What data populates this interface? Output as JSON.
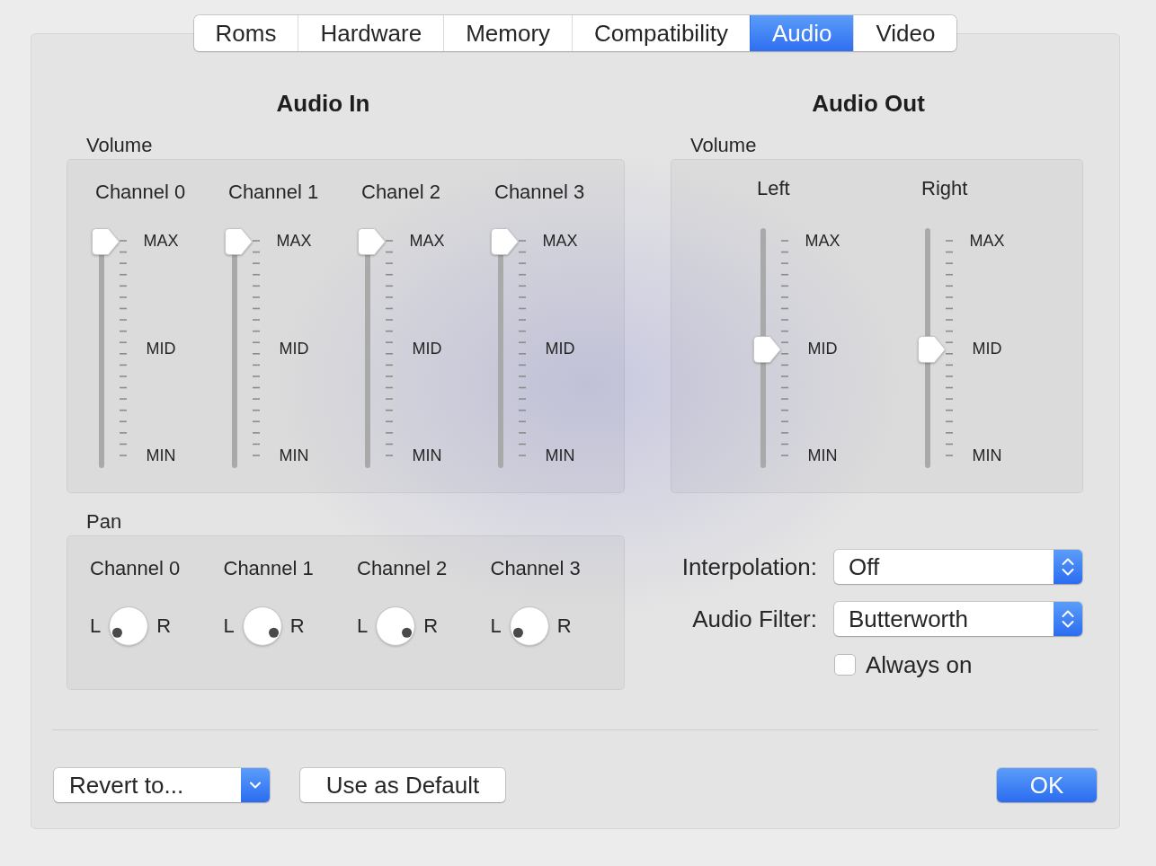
{
  "tabs": [
    {
      "label": "Roms",
      "selected": false
    },
    {
      "label": "Hardware",
      "selected": false
    },
    {
      "label": "Memory",
      "selected": false
    },
    {
      "label": "Compatibility",
      "selected": false
    },
    {
      "label": "Audio",
      "selected": true
    },
    {
      "label": "Video",
      "selected": false
    }
  ],
  "audio_in": {
    "title": "Audio In",
    "volume": {
      "label": "Volume",
      "channels": [
        {
          "name": "Channel 0",
          "level": 1,
          "scale_labels": [
            "MAX",
            "MID",
            "MIN"
          ]
        },
        {
          "name": "Channel 1",
          "level": 1,
          "scale_labels": [
            "MAX",
            "MID",
            "MIN"
          ]
        },
        {
          "name": "Chanel 2",
          "level": 1,
          "scale_labels": [
            "MAX",
            "MID",
            "MIN"
          ]
        },
        {
          "name": "Channel 3",
          "level": 1,
          "scale_labels": [
            "MAX",
            "MID",
            "MIN"
          ]
        }
      ]
    },
    "pan": {
      "label": "Pan",
      "channels": [
        {
          "name": "Channel 0",
          "left_label": "L",
          "right_label": "R",
          "panned_right": false
        },
        {
          "name": "Channel 1",
          "left_label": "L",
          "right_label": "R",
          "panned_right": true
        },
        {
          "name": "Channel 2",
          "left_label": "L",
          "right_label": "R",
          "panned_right": true
        },
        {
          "name": "Channel 3",
          "left_label": "L",
          "right_label": "R",
          "panned_right": false
        }
      ]
    }
  },
  "audio_out": {
    "title": "Audio Out",
    "volume": {
      "label": "Volume",
      "channels": [
        {
          "name": "Left",
          "level": 0.5,
          "scale_labels": [
            "MAX",
            "MID",
            "MIN"
          ]
        },
        {
          "name": "Right",
          "level": 0.5,
          "scale_labels": [
            "MAX",
            "MID",
            "MIN"
          ]
        }
      ]
    },
    "interpolation": {
      "label": "Interpolation:",
      "value": "Off"
    },
    "audio_filter": {
      "label": "Audio Filter:",
      "value": "Butterworth"
    },
    "always_on": {
      "label": "Always on",
      "checked": false
    }
  },
  "footer": {
    "revert_popup": {
      "value": "Revert to..."
    },
    "use_as_default_button": {
      "label": "Use as Default"
    },
    "ok_button": {
      "label": "OK"
    }
  }
}
